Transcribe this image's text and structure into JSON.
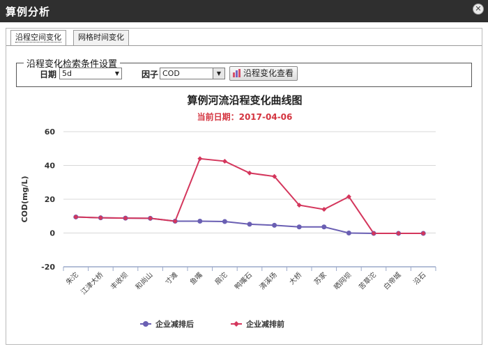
{
  "window": {
    "title": "算例分析"
  },
  "tabs": [
    {
      "label": "沿程空间变化",
      "active": true
    },
    {
      "label": "网格时间变化",
      "active": false
    }
  ],
  "search": {
    "legend": "沿程变化检索条件设置",
    "date_label": "日期",
    "date_value": "5d",
    "factor_label": "因子",
    "factor_value": "COD",
    "view_button": "沿程变化查看"
  },
  "chart_data": {
    "type": "line",
    "title": "算例河流沿程变化曲线图",
    "subtitle": "当前日期：2017-04-06",
    "ylabel": "COD(mg/L)",
    "xlabel": "",
    "ylim": [
      -20,
      60
    ],
    "yticks": [
      60,
      40,
      20,
      0,
      -20
    ],
    "grid": true,
    "legend_position": "bottom",
    "categories": [
      "朱沱",
      "江津大桥",
      "丰收坝",
      "和尚山",
      "寸滩",
      "鱼嘴",
      "扇沱",
      "鸭嘴石",
      "清溪场",
      "大桥",
      "苏家",
      "晒网坝",
      "苦草沱",
      "白帝城",
      "沿石"
    ],
    "series": [
      {
        "name": "企业减排后",
        "color": "#6a5fb3",
        "values": [
          9.5,
          9,
          8.8,
          8.7,
          7,
          7,
          6.8,
          5.2,
          4.6,
          3.6,
          3.6,
          0,
          -0.2,
          -0.2,
          -0.2
        ]
      },
      {
        "name": "企业减排前",
        "color": "#d4365c",
        "values": [
          9.5,
          9,
          8.8,
          8.7,
          7,
          44,
          42.5,
          35.5,
          33.5,
          16.5,
          14,
          21.5,
          -0.2,
          -0.2,
          -0.2
        ]
      }
    ]
  }
}
